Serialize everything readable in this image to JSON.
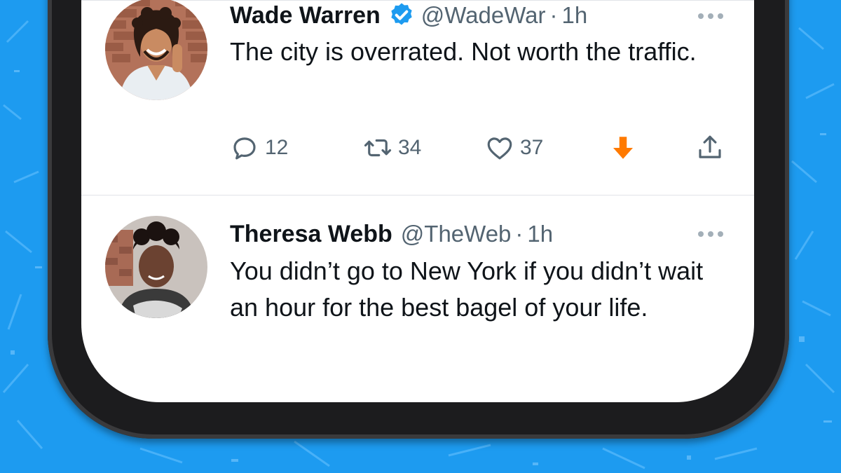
{
  "colors": {
    "background": "#1d9bf0",
    "text": "#0f1419",
    "muted": "#536471",
    "verified": "#1d9bf0",
    "downvote": "#ff7a00"
  },
  "tweets": [
    {
      "name": "Wade Warren",
      "verified": true,
      "handle": "@WadeWar",
      "dot": "·",
      "time": "1h",
      "text": "The city is overrated. Not worth the traffic.",
      "actions": {
        "reply_count": "12",
        "retweet_count": "34",
        "like_count": "37"
      },
      "icons": [
        "reply-icon",
        "retweet-icon",
        "heart-icon",
        "downvote-arrow-icon",
        "share-icon",
        "more-options-icon",
        "verified-badge-icon"
      ]
    },
    {
      "name": "Theresa Webb",
      "verified": false,
      "handle": "@TheWeb",
      "dot": "·",
      "time": "1h",
      "text": "You didn’t go to New York if you didn’t wait an hour for the best bagel of your life.",
      "icons": [
        "more-options-icon"
      ]
    }
  ]
}
